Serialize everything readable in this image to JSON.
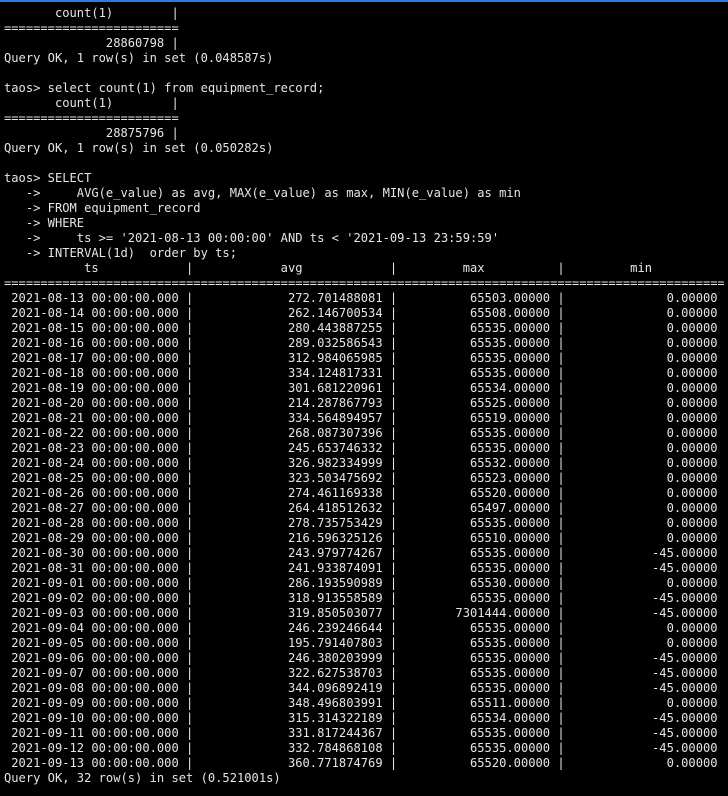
{
  "terminal": {
    "lines": [
      "       count(1)        |",
      "========================",
      "              28860798 |",
      "Query OK, 1 row(s) in set (0.048587s)",
      "",
      "taos> select count(1) from equipment_record;",
      "       count(1)        |",
      "========================",
      "              28875796 |",
      "Query OK, 1 row(s) in set (0.050282s)",
      "",
      "taos> SELECT",
      "   ->     AVG(e_value) as avg, MAX(e_value) as max, MIN(e_value) as min",
      "   -> FROM equipment_record",
      "   -> WHERE",
      "   ->     ts >= '2021-08-13 00:00:00' AND ts < '2021-09-13 23:59:59'",
      "   -> INTERVAL(1d)  order by ts;",
      "           ts            |            avg            |         max          |         min          |",
      "======================================================================================================",
      " 2021-08-13 00:00:00.000 |             272.701488081 |          65503.00000 |              0.00000 |",
      " 2021-08-14 00:00:00.000 |             262.146700534 |          65508.00000 |              0.00000 |",
      " 2021-08-15 00:00:00.000 |             280.443887255 |          65535.00000 |              0.00000 |",
      " 2021-08-16 00:00:00.000 |             289.032586543 |          65535.00000 |              0.00000 |",
      " 2021-08-17 00:00:00.000 |             312.984065985 |          65535.00000 |              0.00000 |",
      " 2021-08-18 00:00:00.000 |             334.124817331 |          65535.00000 |              0.00000 |",
      " 2021-08-19 00:00:00.000 |             301.681220961 |          65534.00000 |              0.00000 |",
      " 2021-08-20 00:00:00.000 |             214.287867793 |          65525.00000 |              0.00000 |",
      " 2021-08-21 00:00:00.000 |             334.564894957 |          65519.00000 |              0.00000 |",
      " 2021-08-22 00:00:00.000 |             268.087307396 |          65535.00000 |              0.00000 |",
      " 2021-08-23 00:00:00.000 |             245.653746332 |          65535.00000 |              0.00000 |",
      " 2021-08-24 00:00:00.000 |             326.982334999 |          65532.00000 |              0.00000 |",
      " 2021-08-25 00:00:00.000 |             323.503475692 |          65523.00000 |              0.00000 |",
      " 2021-08-26 00:00:00.000 |             274.461169338 |          65520.00000 |              0.00000 |",
      " 2021-08-27 00:00:00.000 |             264.418512632 |          65497.00000 |              0.00000 |",
      " 2021-08-28 00:00:00.000 |             278.735753429 |          65535.00000 |              0.00000 |",
      " 2021-08-29 00:00:00.000 |             216.596325126 |          65510.00000 |              0.00000 |",
      " 2021-08-30 00:00:00.000 |             243.979774267 |          65535.00000 |            -45.00000 |",
      " 2021-08-31 00:00:00.000 |             241.933874091 |          65535.00000 |            -45.00000 |",
      " 2021-09-01 00:00:00.000 |             286.193590989 |          65530.00000 |              0.00000 |",
      " 2021-09-02 00:00:00.000 |             318.913558589 |          65535.00000 |            -45.00000 |",
      " 2021-09-03 00:00:00.000 |             319.850503077 |        7301444.00000 |            -45.00000 |",
      " 2021-09-04 00:00:00.000 |             246.239246644 |          65535.00000 |              0.00000 |",
      " 2021-09-05 00:00:00.000 |             195.791407803 |          65535.00000 |              0.00000 |",
      " 2021-09-06 00:00:00.000 |             246.380203999 |          65535.00000 |            -45.00000 |",
      " 2021-09-07 00:00:00.000 |             322.627538703 |          65535.00000 |            -45.00000 |",
      " 2021-09-08 00:00:00.000 |             344.096892419 |          65535.00000 |            -45.00000 |",
      " 2021-09-09 00:00:00.000 |             348.496803991 |          65511.00000 |              0.00000 |",
      " 2021-09-10 00:00:00.000 |             315.314322189 |          65534.00000 |            -45.00000 |",
      " 2021-09-11 00:00:00.000 |             331.817244367 |          65535.00000 |            -45.00000 |",
      " 2021-09-12 00:00:00.000 |             332.784868108 |          65535.00000 |            -45.00000 |",
      " 2021-09-13 00:00:00.000 |             360.771874769 |          65520.00000 |              0.00000 |",
      "Query OK, 32 row(s) in set (0.521001s)"
    ]
  },
  "colors": {
    "background": "#000000",
    "text": "#e6e6e6",
    "top_border": "#2a7fd4"
  }
}
